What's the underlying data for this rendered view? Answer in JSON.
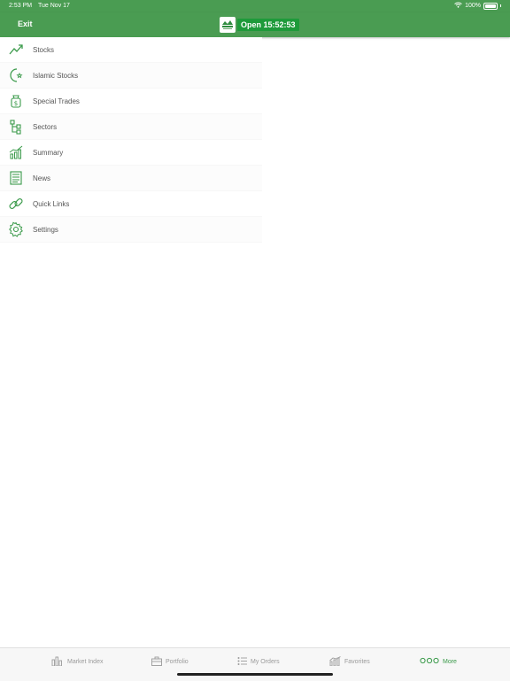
{
  "status_bar": {
    "time": "2:53 PM",
    "date": "Tue Nov 17",
    "battery": "100%"
  },
  "header": {
    "exit_label": "Exit",
    "market_status": "Open 15:52:53"
  },
  "menu": {
    "items": [
      {
        "label": "Stocks",
        "icon": "trend-line-icon"
      },
      {
        "label": "Islamic Stocks",
        "icon": "crescent-star-icon"
      },
      {
        "label": "Special Trades",
        "icon": "money-bag-icon"
      },
      {
        "label": "Sectors",
        "icon": "hierarchy-icon"
      },
      {
        "label": "Summary",
        "icon": "bar-chart-icon"
      },
      {
        "label": "News",
        "icon": "newspaper-icon"
      },
      {
        "label": "Quick Links",
        "icon": "link-icon"
      },
      {
        "label": "Settings",
        "icon": "gear-icon"
      }
    ]
  },
  "tabbar": {
    "tabs": [
      {
        "label": "Market Index",
        "icon": "market-index-icon"
      },
      {
        "label": "Portfolio",
        "icon": "briefcase-icon"
      },
      {
        "label": "My Orders",
        "icon": "orders-list-icon"
      },
      {
        "label": "Favorites",
        "icon": "favorites-chart-icon"
      },
      {
        "label": "More",
        "icon": "more-dots-icon",
        "active": true
      }
    ]
  },
  "colors": {
    "brand_green": "#4a9c52",
    "accent_green": "#3a9a4a",
    "pill_green": "#1e9a3a"
  }
}
